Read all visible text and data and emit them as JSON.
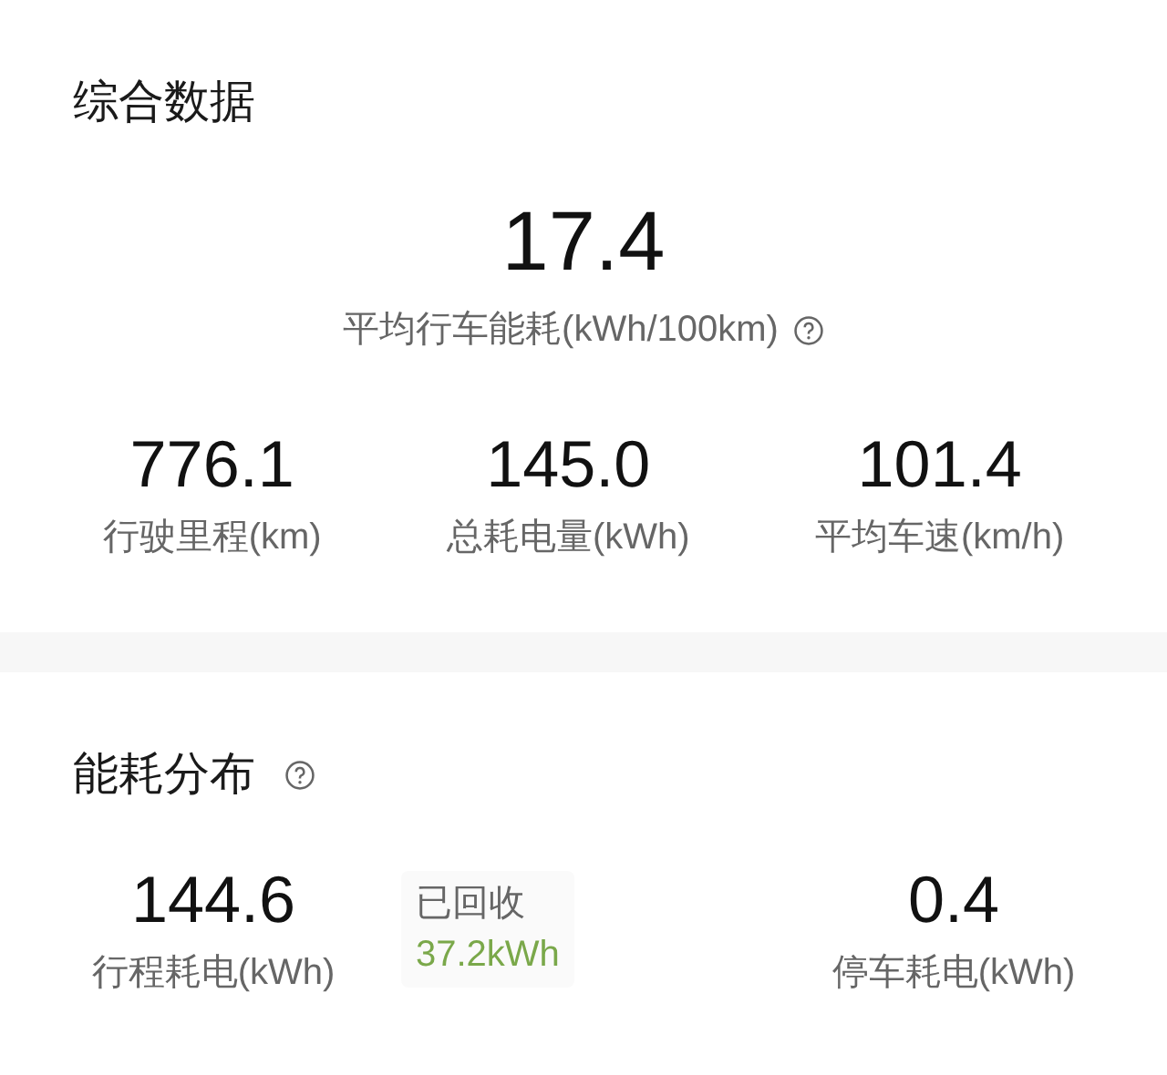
{
  "summary": {
    "title": "综合数据",
    "main": {
      "value": "17.4",
      "label": "平均行车能耗(kWh/100km)"
    },
    "stats": [
      {
        "value": "776.1",
        "label": "行驶里程(km)"
      },
      {
        "value": "145.0",
        "label": "总耗电量(kWh)"
      },
      {
        "value": "101.4",
        "label": "平均车速(km/h)"
      }
    ]
  },
  "distribution": {
    "title": "能耗分布",
    "trip": {
      "value": "144.6",
      "label": "行程耗电(kWh)"
    },
    "recovered": {
      "label": "已回收",
      "value": "37.2kWh"
    },
    "parked": {
      "value": "0.4",
      "label": "停车耗电(kWh)"
    }
  }
}
